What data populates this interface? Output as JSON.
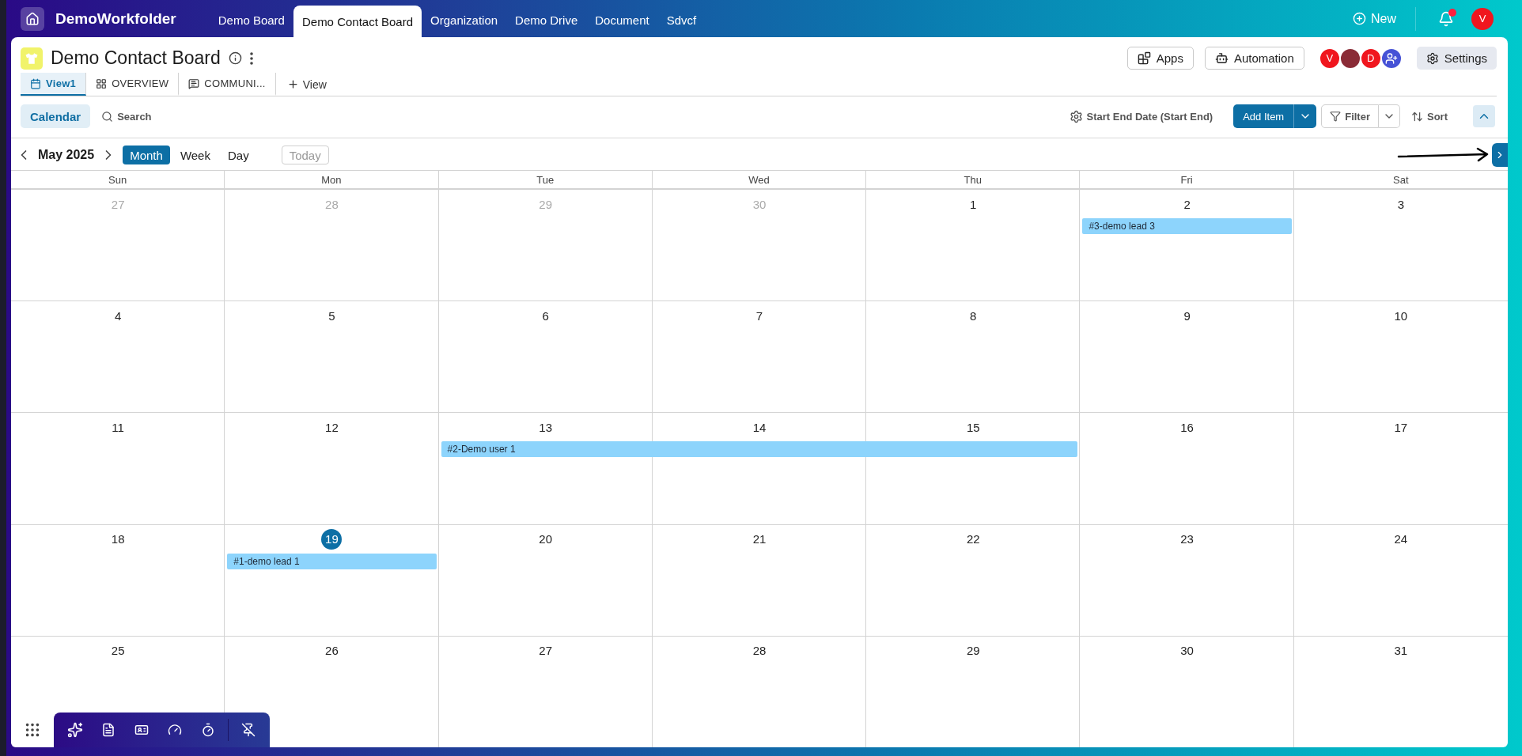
{
  "topbar": {
    "app_name": "DemoWorkfolder",
    "tabs": [
      {
        "label": "Demo Board",
        "selected": false
      },
      {
        "label": "Demo Contact Board",
        "selected": true
      },
      {
        "label": "Organization",
        "selected": false
      },
      {
        "label": "Demo Drive",
        "selected": false
      },
      {
        "label": "Document",
        "selected": false
      },
      {
        "label": "Sdvcf",
        "selected": false
      }
    ],
    "new_label": "New",
    "notification_dot": true,
    "user_initial": "V"
  },
  "board": {
    "title": "Demo Contact Board",
    "views": [
      {
        "label": "View1",
        "kind": "calendar",
        "selected": true
      },
      {
        "label": "OVERVIEW",
        "kind": "overview",
        "selected": false
      },
      {
        "label": "COMMUNI...",
        "kind": "message",
        "selected": false
      }
    ],
    "add_view": "View",
    "actions": [
      {
        "label": "Apps",
        "kind": "apps"
      },
      {
        "label": "Automation",
        "kind": "robot"
      }
    ],
    "members": [
      {
        "kind": "letter",
        "initial": "V"
      },
      {
        "kind": "photo"
      },
      {
        "kind": "letter",
        "initial": "D"
      },
      {
        "kind": "add"
      }
    ],
    "settings": "Settings"
  },
  "toolbar": {
    "modes": [
      {
        "label": "Calendar",
        "selected": true
      }
    ],
    "search": "Search",
    "date_field": "Start End Date (Start End)",
    "add_item": "Add Item",
    "filter": "Filter",
    "sort": "Sort"
  },
  "calendar": {
    "month": "May 2025",
    "ranges": [
      {
        "label": "Month",
        "selected": true
      },
      {
        "label": "Week",
        "selected": false
      },
      {
        "label": "Day",
        "selected": false
      }
    ],
    "today_button": {
      "label": "Today",
      "disabled": true
    },
    "weekdays": [
      "Sun",
      "Mon",
      "Tue",
      "Wed",
      "Thu",
      "Fri",
      "Sat"
    ],
    "weeks": [
      {
        "days": [
          {
            "label": "27",
            "muted": true,
            "today": false
          },
          {
            "label": "28",
            "muted": true,
            "today": false
          },
          {
            "label": "29",
            "muted": true,
            "today": false
          },
          {
            "label": "30",
            "muted": true,
            "today": false
          },
          {
            "label": "1",
            "muted": false,
            "today": false
          },
          {
            "label": "2",
            "muted": false,
            "today": false,
            "event": {
              "label": "#3-demo lead 3"
            }
          },
          {
            "label": "3",
            "muted": false,
            "today": false
          }
        ]
      },
      {
        "days": [
          {
            "label": "4",
            "muted": false,
            "today": false
          },
          {
            "label": "5",
            "muted": false,
            "today": false
          },
          {
            "label": "6",
            "muted": false,
            "today": false
          },
          {
            "label": "7",
            "muted": false,
            "today": false
          },
          {
            "label": "8",
            "muted": false,
            "today": false
          },
          {
            "label": "9",
            "muted": false,
            "today": false
          },
          {
            "label": "10",
            "muted": false,
            "today": false
          }
        ]
      },
      {
        "days": [
          {
            "label": "11",
            "muted": false,
            "today": false
          },
          {
            "label": "12",
            "muted": false,
            "today": false
          },
          {
            "label": "13",
            "muted": false,
            "today": false,
            "event": {
              "label": "#2-Demo user 1"
            }
          },
          {
            "label": "14",
            "muted": false,
            "today": false,
            "event_continues": true
          },
          {
            "label": "15",
            "muted": false,
            "today": false,
            "event_continues": true
          },
          {
            "label": "16",
            "muted": false,
            "today": false
          },
          {
            "label": "17",
            "muted": false,
            "today": false
          }
        ]
      },
      {
        "days": [
          {
            "label": "18",
            "muted": false,
            "today": false
          },
          {
            "label": "19",
            "muted": false,
            "today": true,
            "event": {
              "label": "#1-demo lead 1"
            }
          },
          {
            "label": "20",
            "muted": false,
            "today": false
          },
          {
            "label": "21",
            "muted": false,
            "today": false
          },
          {
            "label": "22",
            "muted": false,
            "today": false
          },
          {
            "label": "23",
            "muted": false,
            "today": false
          },
          {
            "label": "24",
            "muted": false,
            "today": false
          }
        ]
      },
      {
        "days": [
          {
            "label": "25",
            "muted": false,
            "today": false
          },
          {
            "label": "26",
            "muted": false,
            "today": false
          },
          {
            "label": "27",
            "muted": false,
            "today": false
          },
          {
            "label": "28",
            "muted": false,
            "today": false
          },
          {
            "label": "29",
            "muted": false,
            "today": false
          },
          {
            "label": "30",
            "muted": false,
            "today": false
          },
          {
            "label": "31",
            "muted": false,
            "today": false
          }
        ]
      }
    ]
  }
}
